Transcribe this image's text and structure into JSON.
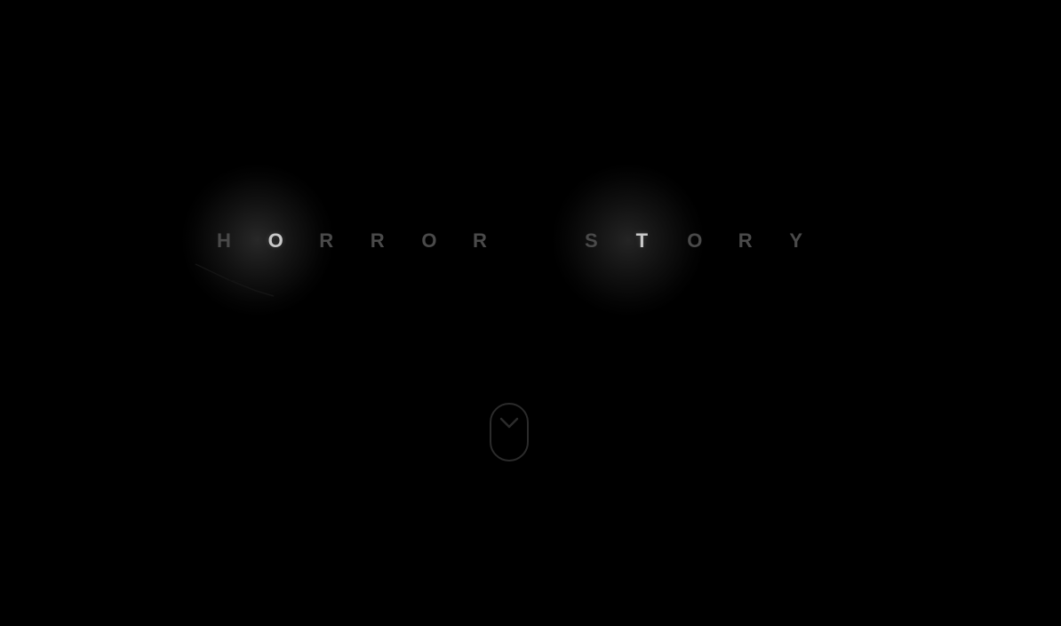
{
  "title": {
    "word_1": [
      "H",
      "O",
      "R",
      "R",
      "O",
      "R"
    ],
    "word_2": [
      "S",
      "T",
      "O",
      "R",
      "Y"
    ],
    "highlighted_letters": [
      "word_1.1",
      "word_2.1"
    ]
  },
  "scroll_indicator": {
    "icon": "chevron-down-icon"
  },
  "colors": {
    "background": "#000000",
    "letter_dim": "#4a4a4a",
    "letter_lit": "#c9c9c9",
    "indicator": "#2b2b2b"
  }
}
